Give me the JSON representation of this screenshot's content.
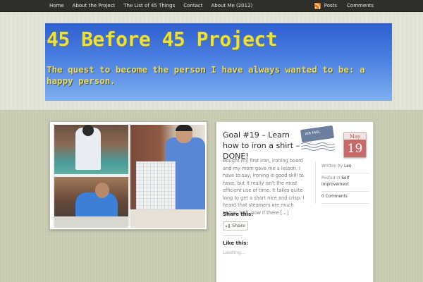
{
  "nav": {
    "items": [
      "Home",
      "About the Project",
      "The List of 45 Things",
      "Contact",
      "About Me (2012)"
    ],
    "right": [
      "Posts",
      "Comments"
    ],
    "rss_icon": "rss-icon"
  },
  "banner": {
    "title": "45 Before 45 Project",
    "tagline": "The quest to become the person I have always wanted to be: a happy person."
  },
  "post": {
    "title": "Goal #19 – Learn how to iron a shirt – DONE!",
    "stamp_label": "AIR MAIL",
    "date_month": "May",
    "date_day": "19",
    "excerpt": "Bought my first iron, ironing board and my mom gave me a lesson. I have to say, ironing is good skill to have, but it really isn't the most efficient use of time. It takes quite long to get a short nice and crisp. I heard that steamers are much better. Still, now if there […]",
    "share_heading": "Share this:",
    "share_button": "Share",
    "like_heading": "Like this:",
    "loading": "Loading...",
    "meta": {
      "written_by_label": "Written by",
      "author": "Leo",
      "posted_in_label": "Posted in",
      "category": "Self Improvement",
      "comments": "0 Comments"
    }
  },
  "colors": {
    "nav_bg": "#2e2e2a",
    "banner_blue": "#2f5fd0",
    "banner_title": "#e8e04a",
    "date_stamp": "#c96a6a"
  }
}
